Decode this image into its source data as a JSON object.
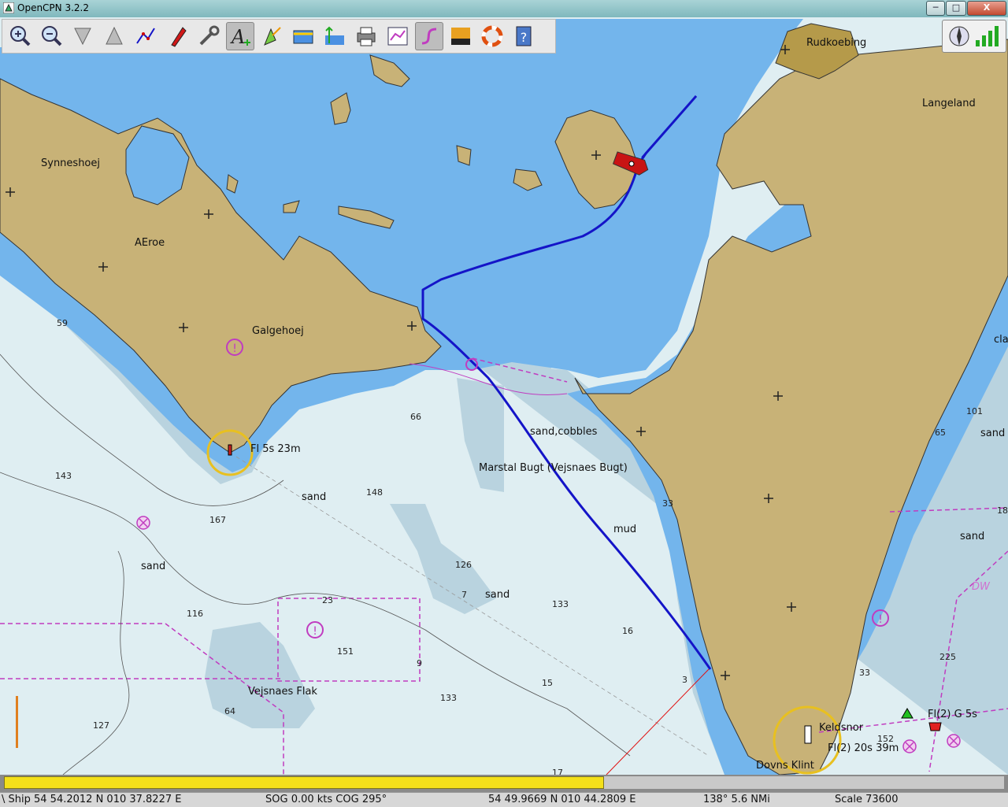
{
  "window": {
    "title": "OpenCPN 3.2.2",
    "min_label": "─",
    "max_label": "□",
    "close_label": "X"
  },
  "toolbar": {
    "buttons": [
      {
        "name": "zoom-in-button",
        "icon": "zoom-in-icon"
      },
      {
        "name": "zoom-out-button",
        "icon": "zoom-out-icon"
      },
      {
        "name": "scale-in-button",
        "icon": "scale-in-icon"
      },
      {
        "name": "scale-out-button",
        "icon": "scale-out-icon"
      },
      {
        "name": "route-button",
        "icon": "route-icon"
      },
      {
        "name": "auto-follow-button",
        "icon": "boat-icon"
      },
      {
        "name": "settings-button",
        "icon": "wrench-icon"
      },
      {
        "name": "text-button",
        "icon": "text-plus-icon",
        "active": true
      },
      {
        "name": "ais-button",
        "icon": "ais-icon"
      },
      {
        "name": "current-button",
        "icon": "current-icon"
      },
      {
        "name": "tide-button",
        "icon": "tide-icon"
      },
      {
        "name": "print-button",
        "icon": "print-icon"
      },
      {
        "name": "route-manager-button",
        "icon": "route-manager-icon"
      },
      {
        "name": "track-button",
        "icon": "track-icon",
        "active": true
      },
      {
        "name": "color-scheme-button",
        "icon": "sunset-icon"
      },
      {
        "name": "mob-button",
        "icon": "lifebuoy-icon"
      },
      {
        "name": "help-button",
        "icon": "help-icon"
      }
    ]
  },
  "labels": {
    "rudkoebing": "Rudkoebing",
    "langeland": "Langeland",
    "synneshoej": "Synneshoej",
    "aeroe": "AEroe",
    "galgehoej": "Galgehoej",
    "light1": "Fl 5s 23m",
    "sand_cobbles": "sand,cobbles",
    "marstal": "Marstal Bugt (Vejsnaes Bugt)",
    "mud": "mud",
    "sand1": "sand",
    "sand2": "sand",
    "sand3": "sand",
    "sand4": "sand",
    "sand5": "sand",
    "vejsnaes_flak": "Vejsnaes Flak",
    "kelds_nor": "Keldsnor",
    "light2": "Fl(2) 20s 39m",
    "light3": "Fl(2) G 5s",
    "dovns_klint": "Dovns Klint",
    "cla": "cla",
    "dw": "DW"
  },
  "soundings": [
    {
      "t": "59"
    },
    {
      "t": "66"
    },
    {
      "t": "143"
    },
    {
      "t": "148"
    },
    {
      "t": "167"
    },
    {
      "t": "126"
    },
    {
      "t": "7"
    },
    {
      "t": "133"
    },
    {
      "t": "16"
    },
    {
      "t": "116"
    },
    {
      "t": "23"
    },
    {
      "t": "151"
    },
    {
      "t": "9"
    },
    {
      "t": "15"
    },
    {
      "t": "133"
    },
    {
      "t": "64"
    },
    {
      "t": "127"
    },
    {
      "t": "3"
    },
    {
      "t": "33"
    },
    {
      "t": "33"
    },
    {
      "t": "101"
    },
    {
      "t": "65"
    },
    {
      "t": "225"
    },
    {
      "t": "152"
    },
    {
      "t": "17"
    },
    {
      "t": "18"
    }
  ],
  "progress": {
    "fraction": 0.6
  },
  "status": {
    "ship": "\\ Ship 54 54.2012 N   010 37.8227 E",
    "sog": "SOG 0.00 kts  COG 295°",
    "cursor": "54 49.9669 N   010 44.2809 E",
    "bearing": "138°  5.6 NMi",
    "scale": "Scale 73600"
  },
  "colors": {
    "land": "#c8b277",
    "deep": "#dfeef2",
    "mid": "#b9d3df",
    "shallow": "#73b5ec",
    "track": "#1414c8",
    "restricted": "#c03cc0"
  }
}
